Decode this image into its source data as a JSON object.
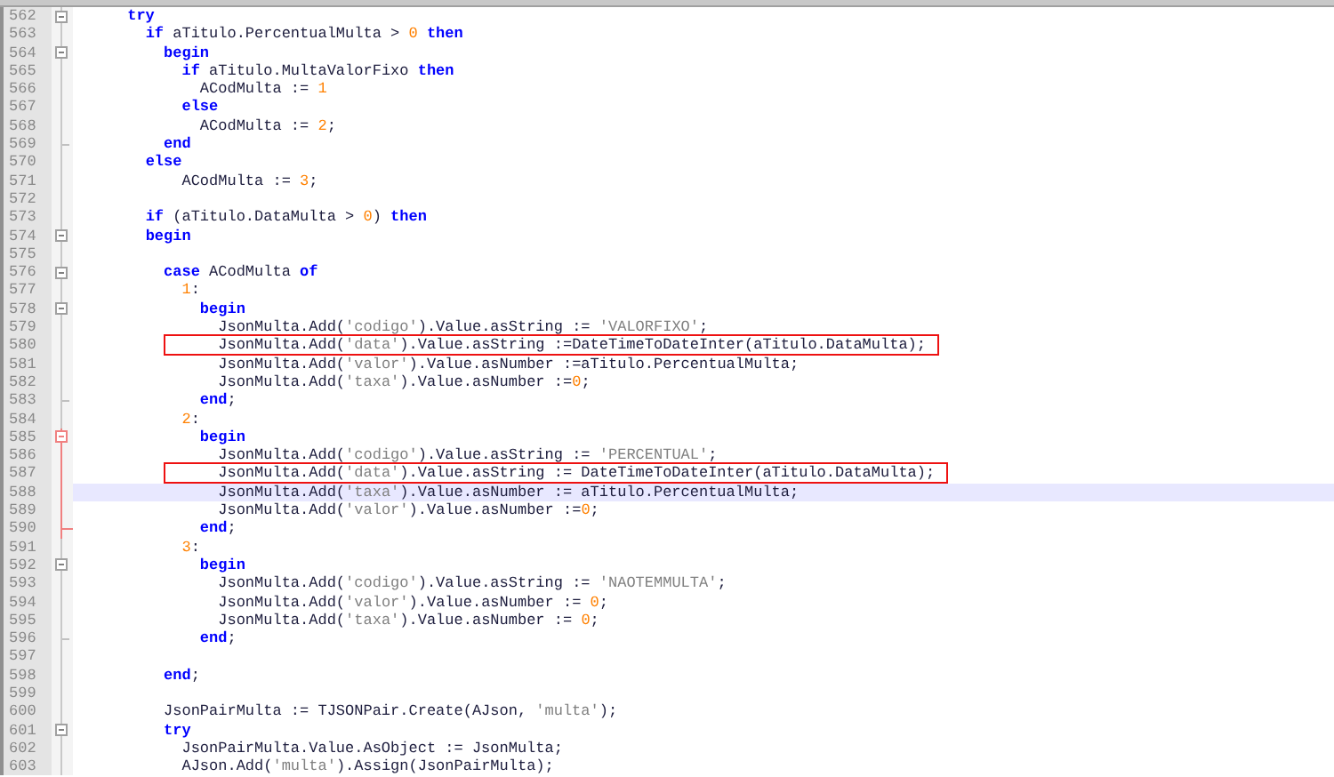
{
  "editor": {
    "lines": [
      {
        "number": "562",
        "fold_start": true,
        "tokens": [
          {
            "kind": "kw",
            "text": "      try"
          }
        ]
      },
      {
        "number": "563",
        "tokens": [
          {
            "kind": "kw",
            "text": "        if"
          },
          {
            "kind": "id",
            "text": " aTitulo.PercentualMulta > "
          },
          {
            "kind": "num",
            "text": "0"
          },
          {
            "kind": "kw",
            "text": " then"
          }
        ]
      },
      {
        "number": "564",
        "fold_start": true,
        "tokens": [
          {
            "kind": "kw",
            "text": "          begin"
          }
        ]
      },
      {
        "number": "565",
        "tokens": [
          {
            "kind": "kw",
            "text": "            if"
          },
          {
            "kind": "id",
            "text": " aTitulo.MultaValorFixo "
          },
          {
            "kind": "kw",
            "text": "then"
          }
        ]
      },
      {
        "number": "566",
        "tokens": [
          {
            "kind": "id",
            "text": "              ACodMulta := "
          },
          {
            "kind": "num",
            "text": "1"
          }
        ]
      },
      {
        "number": "567",
        "tokens": [
          {
            "kind": "kw",
            "text": "            else"
          }
        ]
      },
      {
        "number": "568",
        "tokens": [
          {
            "kind": "id",
            "text": "              ACodMulta := "
          },
          {
            "kind": "num",
            "text": "2"
          },
          {
            "kind": "id",
            "text": ";"
          }
        ]
      },
      {
        "number": "569",
        "fold_end": true,
        "tokens": [
          {
            "kind": "kw",
            "text": "          end"
          }
        ]
      },
      {
        "number": "570",
        "tokens": [
          {
            "kind": "kw",
            "text": "        else"
          }
        ]
      },
      {
        "number": "571",
        "tokens": [
          {
            "kind": "id",
            "text": "            ACodMulta := "
          },
          {
            "kind": "num",
            "text": "3"
          },
          {
            "kind": "id",
            "text": ";"
          }
        ]
      },
      {
        "number": "572"
      },
      {
        "number": "573",
        "tokens": [
          {
            "kind": "kw",
            "text": "        if"
          },
          {
            "kind": "id",
            "text": " (aTitulo.DataMulta > "
          },
          {
            "kind": "num",
            "text": "0"
          },
          {
            "kind": "id",
            "text": ") "
          },
          {
            "kind": "kw",
            "text": "then"
          }
        ]
      },
      {
        "number": "574",
        "fold_start": true,
        "tokens": [
          {
            "kind": "kw",
            "text": "        begin"
          }
        ]
      },
      {
        "number": "575"
      },
      {
        "number": "576",
        "fold_start": true,
        "tokens": [
          {
            "kind": "kw",
            "text": "          case"
          },
          {
            "kind": "id",
            "text": " ACodMulta "
          },
          {
            "kind": "kw",
            "text": "of"
          }
        ]
      },
      {
        "number": "577",
        "tokens": [
          {
            "kind": "num",
            "text": "            1"
          },
          {
            "kind": "id",
            "text": ":"
          }
        ]
      },
      {
        "number": "578",
        "fold_start": true,
        "tokens": [
          {
            "kind": "kw",
            "text": "              begin"
          }
        ]
      },
      {
        "number": "579",
        "tokens": [
          {
            "kind": "id",
            "text": "                JsonMulta.Add("
          },
          {
            "kind": "str",
            "text": "'codigo'"
          },
          {
            "kind": "id",
            "text": ").Value.asString := "
          },
          {
            "kind": "str",
            "text": "'VALORFIXO'"
          },
          {
            "kind": "id",
            "text": ";"
          }
        ]
      },
      {
        "number": "580",
        "boxed": true,
        "tokens": [
          {
            "kind": "id",
            "text": "                JsonMulta.Add("
          },
          {
            "kind": "str",
            "text": "'data'"
          },
          {
            "kind": "id",
            "text": ").Value.asString :=DateTimeToDateInter(aTitulo.DataMulta);"
          }
        ]
      },
      {
        "number": "581",
        "tokens": [
          {
            "kind": "id",
            "text": "                JsonMulta.Add("
          },
          {
            "kind": "str",
            "text": "'valor'"
          },
          {
            "kind": "id",
            "text": ").Value.asNumber :=aTitulo.PercentualMulta;"
          }
        ]
      },
      {
        "number": "582",
        "tokens": [
          {
            "kind": "id",
            "text": "                JsonMulta.Add("
          },
          {
            "kind": "str",
            "text": "'taxa'"
          },
          {
            "kind": "id",
            "text": ").Value.asNumber :="
          },
          {
            "kind": "num",
            "text": "0"
          },
          {
            "kind": "id",
            "text": ";"
          }
        ]
      },
      {
        "number": "583",
        "fold_end": true,
        "tokens": [
          {
            "kind": "kw",
            "text": "              end"
          },
          {
            "kind": "id",
            "text": ";"
          }
        ]
      },
      {
        "number": "584",
        "tokens": [
          {
            "kind": "num",
            "text": "            2"
          },
          {
            "kind": "id",
            "text": ":"
          }
        ]
      },
      {
        "number": "585",
        "fold_start": true,
        "changed": true,
        "tokens": [
          {
            "kind": "kw",
            "text": "              begin"
          }
        ]
      },
      {
        "number": "586",
        "changed": true,
        "tokens": [
          {
            "kind": "id",
            "text": "                JsonMulta.Add("
          },
          {
            "kind": "str",
            "text": "'codigo'"
          },
          {
            "kind": "id",
            "text": ").Value.asString := "
          },
          {
            "kind": "str",
            "text": "'PERCENTUAL'"
          },
          {
            "kind": "id",
            "text": ";"
          }
        ]
      },
      {
        "number": "587",
        "changed": true,
        "boxed": true,
        "tokens": [
          {
            "kind": "id",
            "text": "                JsonMulta.Add("
          },
          {
            "kind": "str",
            "text": "'data'"
          },
          {
            "kind": "id",
            "text": ").Value.asString := DateTimeToDateInter(aTitulo.DataMulta);"
          }
        ]
      },
      {
        "number": "588",
        "changed": true,
        "current": true,
        "tokens": [
          {
            "kind": "id",
            "text": "                JsonMulta.Add("
          },
          {
            "kind": "str",
            "text": "'taxa'"
          },
          {
            "kind": "id",
            "text": ").Value.asNumber := aTitulo.PercentualMulta;"
          }
        ]
      },
      {
        "number": "589",
        "changed": true,
        "tokens": [
          {
            "kind": "id",
            "text": "                JsonMulta.Add("
          },
          {
            "kind": "str",
            "text": "'valor'"
          },
          {
            "kind": "id",
            "text": ").Value.asNumber :="
          },
          {
            "kind": "num",
            "text": "0"
          },
          {
            "kind": "id",
            "text": ";"
          }
        ]
      },
      {
        "number": "590",
        "fold_end": true,
        "changed": true,
        "tokens": [
          {
            "kind": "kw",
            "text": "              end"
          },
          {
            "kind": "id",
            "text": ";"
          }
        ]
      },
      {
        "number": "591",
        "tokens": [
          {
            "kind": "num",
            "text": "            3"
          },
          {
            "kind": "id",
            "text": ":"
          }
        ]
      },
      {
        "number": "592",
        "fold_start": true,
        "tokens": [
          {
            "kind": "kw",
            "text": "              begin"
          }
        ]
      },
      {
        "number": "593",
        "tokens": [
          {
            "kind": "id",
            "text": "                JsonMulta.Add("
          },
          {
            "kind": "str",
            "text": "'codigo'"
          },
          {
            "kind": "id",
            "text": ").Value.asString := "
          },
          {
            "kind": "str",
            "text": "'NAOTEMMULTA'"
          },
          {
            "kind": "id",
            "text": ";"
          }
        ]
      },
      {
        "number": "594",
        "tokens": [
          {
            "kind": "id",
            "text": "                JsonMulta.Add("
          },
          {
            "kind": "str",
            "text": "'valor'"
          },
          {
            "kind": "id",
            "text": ").Value.asNumber := "
          },
          {
            "kind": "num",
            "text": "0"
          },
          {
            "kind": "id",
            "text": ";"
          }
        ]
      },
      {
        "number": "595",
        "tokens": [
          {
            "kind": "id",
            "text": "                JsonMulta.Add("
          },
          {
            "kind": "str",
            "text": "'taxa'"
          },
          {
            "kind": "id",
            "text": ").Value.asNumber := "
          },
          {
            "kind": "num",
            "text": "0"
          },
          {
            "kind": "id",
            "text": ";"
          }
        ]
      },
      {
        "number": "596",
        "fold_end": true,
        "tokens": [
          {
            "kind": "kw",
            "text": "              end"
          },
          {
            "kind": "id",
            "text": ";"
          }
        ]
      },
      {
        "number": "597"
      },
      {
        "number": "598",
        "tokens": [
          {
            "kind": "kw",
            "text": "          end"
          },
          {
            "kind": "id",
            "text": ";"
          }
        ]
      },
      {
        "number": "599"
      },
      {
        "number": "600",
        "tokens": [
          {
            "kind": "id",
            "text": "          JsonPairMulta := TJSONPair.Create(AJson, "
          },
          {
            "kind": "str",
            "text": "'multa'"
          },
          {
            "kind": "id",
            "text": ");"
          }
        ]
      },
      {
        "number": "601",
        "fold_start": true,
        "tokens": [
          {
            "kind": "kw",
            "text": "          try"
          }
        ]
      },
      {
        "number": "602",
        "tokens": [
          {
            "kind": "id",
            "text": "            JsonPairMulta.Value.AsObject := JsonMulta;"
          }
        ]
      },
      {
        "number": "603",
        "tokens": [
          {
            "kind": "id",
            "text": "            AJson.Add("
          },
          {
            "kind": "str",
            "text": "'multa'"
          },
          {
            "kind": "id",
            "text": ").Assign(JsonPairMulta);"
          }
        ]
      }
    ]
  }
}
